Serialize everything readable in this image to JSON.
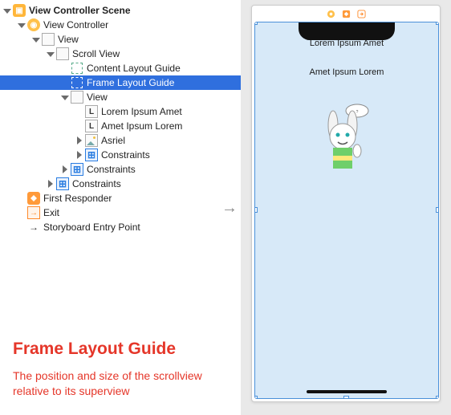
{
  "tree": {
    "scene": "View Controller Scene",
    "vc": "View Controller",
    "view": "View",
    "scroll": "Scroll View",
    "content_guide": "Content Layout Guide",
    "frame_guide": "Frame Layout Guide",
    "inner_view": "View",
    "label1": "Lorem Ipsum Amet",
    "label2": "Amet Ipsum Lorem",
    "asriel": "Asriel",
    "constraints": "Constraints",
    "first_responder": "First Responder",
    "exit": "Exit",
    "entry": "Storyboard Entry Point"
  },
  "annotation": {
    "title": "Frame Layout Guide",
    "subtitle": "The position and size of the scrollview relative to its superview"
  },
  "canvas": {
    "label1": "Lorem Ipsum Amet",
    "label2": "Amet Ipsum Lorem"
  }
}
